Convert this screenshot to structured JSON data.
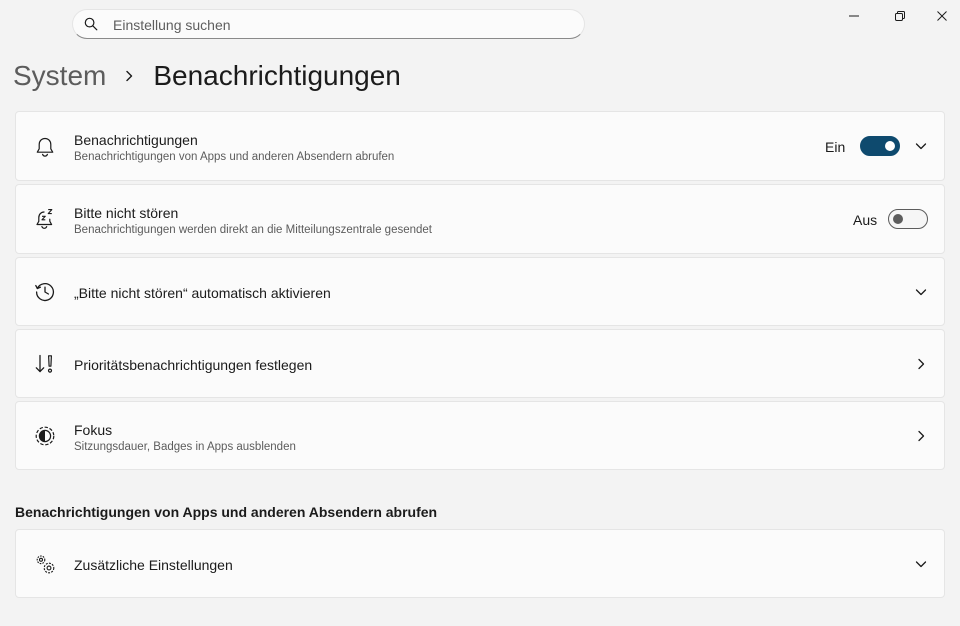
{
  "search": {
    "placeholder": "Einstellung suchen",
    "value": ""
  },
  "window_controls": {
    "minimize": "minimize-icon",
    "restore": "restore-icon",
    "close": "close-icon"
  },
  "breadcrumb": {
    "parent": "System",
    "current": "Benachrichtigungen"
  },
  "items": [
    {
      "title": "Benachrichtigungen",
      "description": "Benachrichtigungen von Apps und anderen Absendern abrufen",
      "state_label": "Ein",
      "toggle_on": true,
      "icon": "bell-icon",
      "action": "expand"
    },
    {
      "title": "Bitte nicht stören",
      "description": "Benachrichtigungen werden direkt an die Mitteilungszentrale gesendet",
      "state_label": "Aus",
      "toggle_on": false,
      "icon": "bell-snooze-icon"
    },
    {
      "title": "„Bitte nicht stören“ automatisch aktivieren",
      "icon": "clock-icon",
      "action": "expand"
    },
    {
      "title": "Prioritätsbenachrichtigungen festlegen",
      "icon": "priority-icon",
      "action": "navigate"
    },
    {
      "title": "Fokus",
      "description": "Sitzungsdauer, Badges in Apps ausblenden",
      "icon": "focus-icon",
      "action": "navigate"
    }
  ],
  "section": {
    "heading": "Benachrichtigungen von Apps und anderen Absendern abrufen",
    "items": [
      {
        "title": "Zusätzliche Einstellungen",
        "icon": "gears-icon",
        "action": "expand"
      }
    ]
  },
  "colors": {
    "accent": "#0e4a6e",
    "background": "#f3f3f3",
    "card": "#fbfbfb"
  }
}
